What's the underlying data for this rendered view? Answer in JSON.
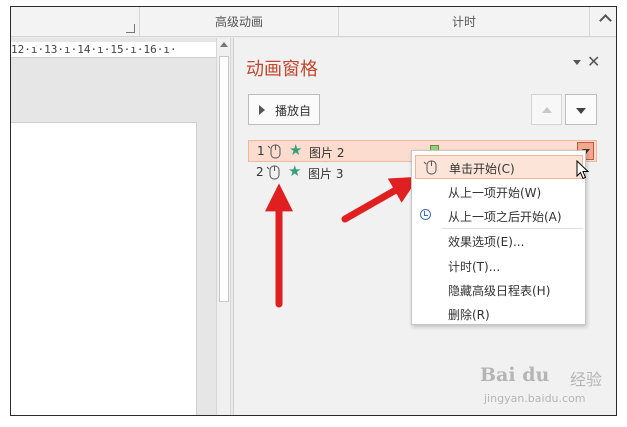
{
  "ribbon": {
    "groups": [
      "高级动画",
      "计时"
    ]
  },
  "ruler": {
    "text": "12·ı·13·ı·14·ı·15·ı·16·ı·"
  },
  "pane": {
    "title": "动画窗格",
    "play_button": "播放自",
    "items": [
      {
        "number": "1",
        "name": "图片 2",
        "selected": true
      },
      {
        "number": "2",
        "name": "图片 3",
        "selected": false
      }
    ]
  },
  "context_menu": {
    "items": [
      {
        "label": "单击开始(C)",
        "icon": "mouse-icon"
      },
      {
        "label": "从上一项开始(W)",
        "icon": ""
      },
      {
        "label": "从上一项之后开始(A)",
        "icon": "clock-icon"
      },
      {
        "label": "效果选项(E)...",
        "icon": ""
      },
      {
        "label": "计时(T)...",
        "icon": ""
      },
      {
        "label": "隐藏高级日程表(H)",
        "icon": ""
      },
      {
        "label": "删除(R)",
        "icon": ""
      }
    ]
  },
  "watermark": {
    "brand": "Bai du",
    "cn": "经验",
    "url": "jingyan.baidu.com"
  },
  "colors": {
    "title": "#c2472e",
    "selection": "#fbdccf",
    "arrow": "#e02020",
    "star": "#3a9e7a"
  }
}
